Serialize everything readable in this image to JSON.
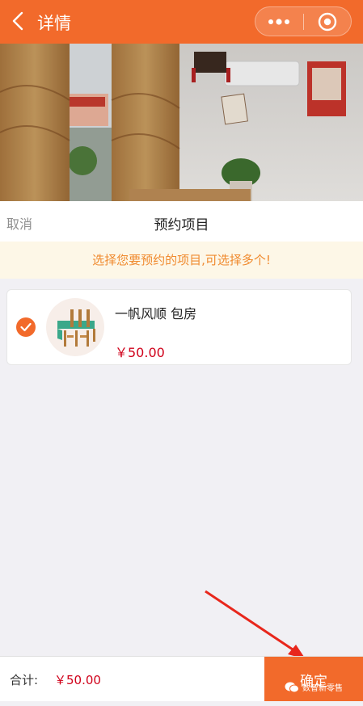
{
  "header": {
    "title": "详情",
    "accent": "#f26a2b"
  },
  "sheet": {
    "cancel_label": "取消",
    "title": "预约项目",
    "notice": "选择您要预约的项目,可选择多个!"
  },
  "items": [
    {
      "name": "一帆风顺 包房",
      "price": "￥50.00",
      "checked": true,
      "icon": "dining-table-icon"
    }
  ],
  "footer": {
    "total_label": "合计:",
    "total_value": "￥50.00",
    "confirm_label": "确定",
    "watermark": "数智新零售"
  }
}
